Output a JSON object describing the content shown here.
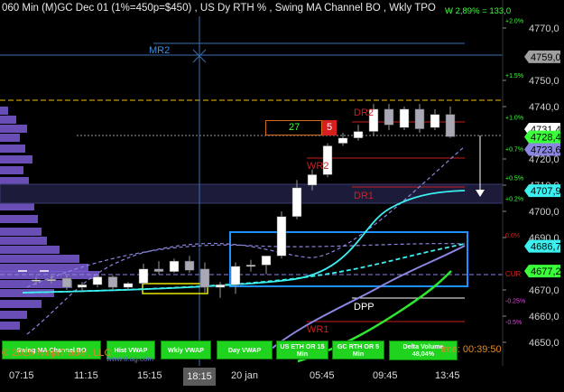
{
  "header": {
    "title": "060 Min  (M)GC Dec 01 (1%=450p=$450) , US Dy RTH % , Swing MA Channel BO , Wkly TPO",
    "weekly_stat": "W 2,89% = 133,0"
  },
  "price_axis": {
    "labels": [
      "4770,0",
      "4750,0",
      "4740,0",
      "4720,0",
      "4710,0",
      "4700,0",
      "4690,0",
      "4670,0",
      "4660,0",
      "4650,0"
    ],
    "percent_labels": [
      "+2.0%",
      "+1.5%",
      "+1.0%",
      "+0.7%",
      "+0.5%",
      "+0.2%",
      "0.0%",
      "-0.25%",
      "-0.5%"
    ],
    "tags": [
      {
        "text": "4759,0",
        "bg": "#a0a0a0",
        "fg": "#000"
      },
      {
        "text": "4731,4",
        "bg": "#ffffff",
        "fg": "#000"
      },
      {
        "text": "4728,4",
        "bg": "#3cff3c",
        "fg": "#000"
      },
      {
        "text": "4723,6",
        "bg": "#8b86e0",
        "fg": "#000"
      },
      {
        "text": "4707,9",
        "bg": "#3cf0f0",
        "fg": "#000"
      },
      {
        "text": "4686,7",
        "bg": "#3cf0f0",
        "fg": "#000"
      },
      {
        "text": "4677,2",
        "bg": "#3cff3c",
        "fg": "#000"
      }
    ]
  },
  "levels": {
    "mr2": "MR2",
    "dr2": "DR2",
    "wr2": "WR2",
    "dr1": "DR1",
    "dpp": "DPP",
    "wr1": "WR1",
    "cur": "CUR"
  },
  "order_box": {
    "qty": "27",
    "count": "5"
  },
  "time_axis": {
    "labels": [
      "07:15",
      "11:15",
      "15:15",
      "18:15",
      "20 jan",
      "05:45",
      "09:45",
      "13:45"
    ],
    "selected": "18:15"
  },
  "buttons": [
    {
      "label": "Swing MA Channel BO"
    },
    {
      "label": "Hist VWAP"
    },
    {
      "label": "Wkly VWAP"
    },
    {
      "label": "Day VWAP"
    },
    {
      "label": "US ETH OR 15\nMin"
    },
    {
      "label": "GC RTH OR 5\nMin"
    },
    {
      "label": "Delta Volume\n48,04%"
    }
  ],
  "footer": {
    "copyright": "© 2026 NinjaTrader, LLC",
    "watermark": "www.tr.ag.com",
    "timer": "ime: 00:39:50"
  },
  "colors": {
    "bullish": "#ffffff",
    "bearish": "#a9a9b5",
    "cyan": "#3cf0f0",
    "purple": "#8b86e0",
    "green": "#2ee82e",
    "red": "#c81e1e",
    "blue_box": "#1e90ff",
    "profile": "#7b5cd6",
    "accent": "#d18a2a"
  },
  "chart_data": {
    "type": "candlestick",
    "candles": [
      {
        "o": 4673.5,
        "h": 4675,
        "l": 4672,
        "c": 4673.8
      },
      {
        "o": 4673.8,
        "h": 4675.5,
        "l": 4672.5,
        "c": 4674
      },
      {
        "o": 4674.5,
        "h": 4675.5,
        "l": 4670,
        "c": 4671
      },
      {
        "o": 4671,
        "h": 4673,
        "l": 4669.5,
        "c": 4672
      },
      {
        "o": 4672,
        "h": 4675.5,
        "l": 4671,
        "c": 4675
      },
      {
        "o": 4675,
        "h": 4675.5,
        "l": 4670,
        "c": 4671
      },
      {
        "o": 4671,
        "h": 4673,
        "l": 4670,
        "c": 4672.5
      },
      {
        "o": 4672.5,
        "h": 4680,
        "l": 4672,
        "c": 4678
      },
      {
        "o": 4678,
        "h": 4681,
        "l": 4676,
        "c": 4677
      },
      {
        "o": 4677,
        "h": 4682,
        "l": 4676.5,
        "c": 4681
      },
      {
        "o": 4681,
        "h": 4683,
        "l": 4676.5,
        "c": 4677.5
      },
      {
        "o": 4678,
        "h": 4680.5,
        "l": 4669,
        "c": 4671
      },
      {
        "o": 4671,
        "h": 4673,
        "l": 4667,
        "c": 4672
      },
      {
        "o": 4672,
        "h": 4680.5,
        "l": 4668.5,
        "c": 4679
      },
      {
        "o": 4679,
        "h": 4681.5,
        "l": 4677,
        "c": 4679.5
      },
      {
        "o": 4679.5,
        "h": 4682,
        "l": 4676,
        "c": 4683
      },
      {
        "o": 4683,
        "h": 4700,
        "l": 4682,
        "c": 4698
      },
      {
        "o": 4698,
        "h": 4712,
        "l": 4697,
        "c": 4709
      },
      {
        "o": 4710,
        "h": 4716,
        "l": 4708,
        "c": 4714
      },
      {
        "o": 4714,
        "h": 4726,
        "l": 4713,
        "c": 4725
      },
      {
        "o": 4726,
        "h": 4730,
        "l": 4725,
        "c": 4728
      },
      {
        "o": 4728,
        "h": 4733,
        "l": 4727,
        "c": 4730.5
      },
      {
        "o": 4730.5,
        "h": 4741,
        "l": 4729,
        "c": 4739
      },
      {
        "o": 4739,
        "h": 4741,
        "l": 4731,
        "c": 4733
      },
      {
        "o": 4732,
        "h": 4740,
        "l": 4731,
        "c": 4739
      },
      {
        "o": 4739,
        "h": 4741,
        "l": 4730,
        "c": 4731.5
      },
      {
        "o": 4732,
        "h": 4739,
        "l": 4731,
        "c": 4737
      },
      {
        "o": 4737,
        "h": 4740,
        "l": 4728,
        "c": 4728.5
      }
    ]
  }
}
